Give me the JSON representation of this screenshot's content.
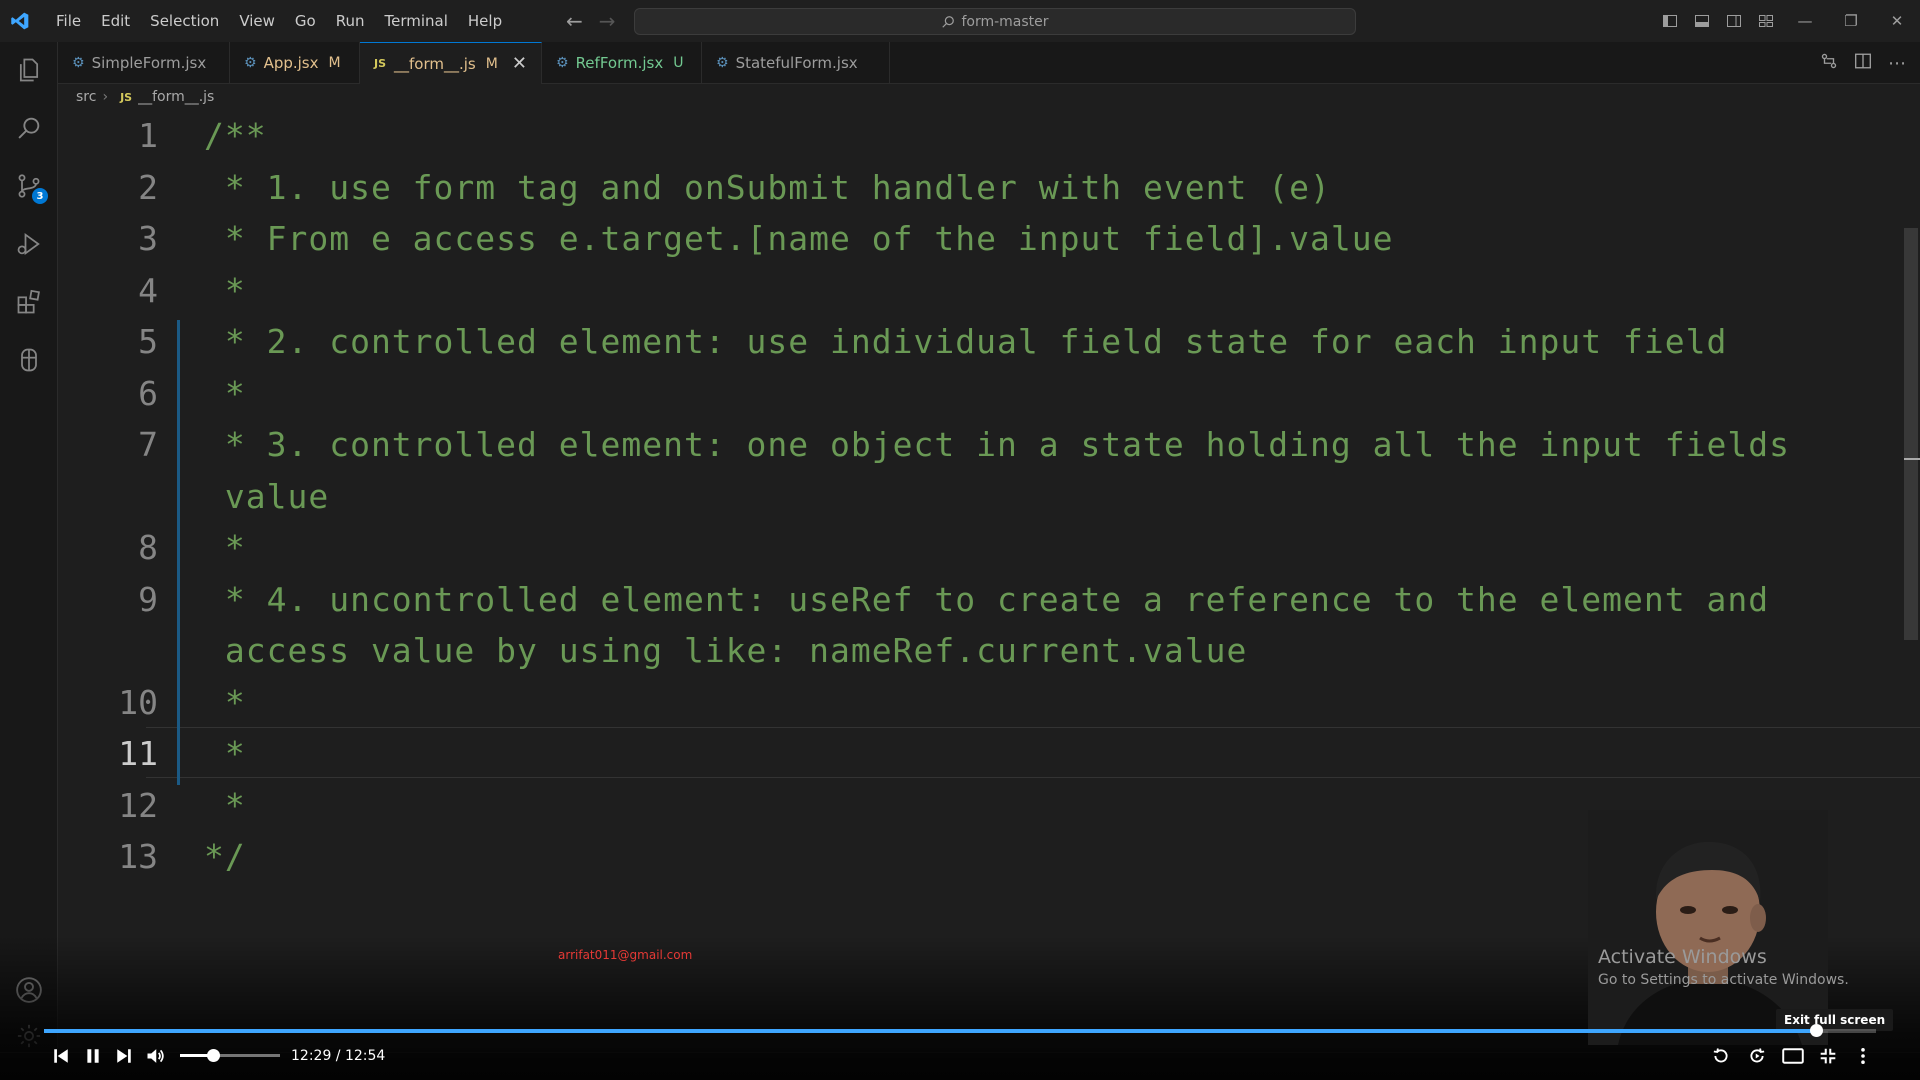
{
  "window": {
    "search_text": "form-master"
  },
  "menu": [
    "File",
    "Edit",
    "Selection",
    "View",
    "Go",
    "Run",
    "Terminal",
    "Help"
  ],
  "tabs": [
    {
      "label": "SimpleForm.jsx",
      "status": ""
    },
    {
      "label": "App.jsx",
      "status": "M"
    },
    {
      "label": "__form__.js",
      "status": "M"
    },
    {
      "label": "RefForm.jsx",
      "status": "U"
    },
    {
      "label": "StatefulForm.jsx",
      "status": ""
    }
  ],
  "breadcrumb": {
    "folder": "src",
    "file_icon": "JS",
    "file": "__form__.js"
  },
  "file_icon_label": "JS",
  "source_control_badge": "3",
  "editor": {
    "lines": [
      {
        "num": "1",
        "text": "/**"
      },
      {
        "num": "2",
        "text": " * 1. use form tag and onSubmit handler with event (e)"
      },
      {
        "num": "3",
        "text": " * From e access e.target.[name of the input field].value"
      },
      {
        "num": "4",
        "text": " *"
      },
      {
        "num": "5",
        "text": " * 2. controlled element: use individual field state for each input field"
      },
      {
        "num": "6",
        "text": " *"
      },
      {
        "num": "7",
        "text": " * 3. controlled element: one object in a state holding all the input fields"
      },
      {
        "num": "",
        "text": " value"
      },
      {
        "num": "8",
        "text": " *"
      },
      {
        "num": "9",
        "text": " * 4. uncontrolled element: useRef to create a reference to the element and"
      },
      {
        "num": "",
        "text": " access value by using like: nameRef.current.value"
      },
      {
        "num": "10",
        "text": " *"
      },
      {
        "num": "11",
        "text": " *"
      },
      {
        "num": "12",
        "text": " *"
      },
      {
        "num": "13",
        "text": "*/"
      }
    ],
    "current_line": "11"
  },
  "overlay": {
    "email": "arrifat011@gmail.com",
    "activate_title": "Activate Windows",
    "activate_sub": "Go to Settings to activate Windows.",
    "tooltip": "Exit full screen"
  },
  "video": {
    "time": "12:29 / 12:54",
    "progress": 0.967,
    "volume": 0.33
  },
  "colors": {
    "comment": "#6a9955",
    "accent": "#0078d4",
    "progress": "#3ea6ff",
    "modified": "#e2c08d",
    "untracked": "#73c991"
  },
  "icons": {
    "activity": [
      "explorer-icon",
      "search-icon",
      "source-control-icon",
      "run-debug-icon",
      "extensions-icon",
      "git-graph-icon",
      "account-icon",
      "settings-gear-icon"
    ],
    "player": [
      "previous-icon",
      "pause-icon",
      "next-icon",
      "volume-icon",
      "replay-icon",
      "autoplay-icon",
      "theater-icon",
      "exit-fullscreen-icon",
      "more-icon"
    ]
  }
}
